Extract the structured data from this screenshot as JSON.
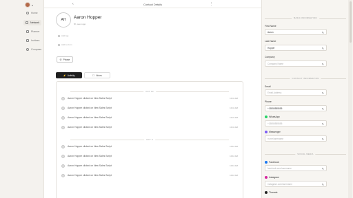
{
  "nav": {
    "items": [
      {
        "label": "Home"
      },
      {
        "label": "Network"
      },
      {
        "label": "Planner"
      },
      {
        "label": "Invitees"
      },
      {
        "label": "Compass"
      }
    ]
  },
  "topbar": {
    "back": "‹",
    "title": "Contact Details",
    "more": "⋮"
  },
  "contact": {
    "initials": "AH",
    "name": "Aaron Hopper",
    "last_seen": "5h, seen ago",
    "add_tag": "Add tag",
    "add_from": "Add to from",
    "phone_button": "Phone"
  },
  "tabs": [
    {
      "label": "Activity"
    },
    {
      "label": "Notes"
    }
  ],
  "activity": {
    "days": [
      {
        "label": "OCT 10",
        "entries": [
          {
            "text": "Aaron Hopper clicked on New Sales Script",
            "time": "10:41 AM"
          },
          {
            "text": "Aaron Hopper clicked on New Sales Script",
            "time": "10:41 AM"
          },
          {
            "text": "Aaron Hopper clicked on New Sales Script",
            "time": "10:41 AM"
          },
          {
            "text": "Aaron Hopper clicked on New Sales Script",
            "time": "10:41 AM"
          }
        ]
      },
      {
        "label": "OCT 9",
        "entries": [
          {
            "text": "Aaron Hopper clicked on New Sales Script",
            "time": "10:10 AM"
          },
          {
            "text": "Aaron Hopper clicked on New Sales Script",
            "time": "10:10 AM"
          },
          {
            "text": "Aaron Hopper clicked on New Sales Script",
            "time": "10:10 AM"
          },
          {
            "text": "Aaron Hopper clicked on New Sales Script",
            "time": "10:10 AM"
          }
        ]
      }
    ]
  },
  "details": {
    "basic_title": "BASIC INFORMATION",
    "first_name_label": "First Name",
    "first_name_value": "Aaron",
    "last_name_label": "Last Name",
    "last_name_value": "Hopper",
    "company_label": "Company",
    "company_placeholder": "Company Name",
    "contact_title": "CONTACT INFORMATION",
    "email_label": "Email",
    "email_placeholder": "Email Address",
    "phone_label": "Phone",
    "phone_value": "+15555555555",
    "whatsapp_label": "WhatsApp",
    "whatsapp_placeholder": "+15555555555",
    "messenger_label": "Messenger",
    "messenger_placeholder": "m.me/username",
    "social_title": "SOCIAL MEDIA",
    "facebook_label": "Facebook",
    "facebook_placeholder": "facebook.com/username",
    "instagram_label": "Instagram",
    "instagram_placeholder": "instagram.com/username",
    "threads_label": "Threads"
  },
  "colors": {
    "whatsapp": "#25d366",
    "messenger": "#7b5cf5",
    "facebook": "#1877f2",
    "instagram": "#d6249f",
    "threads": "#222222"
  }
}
